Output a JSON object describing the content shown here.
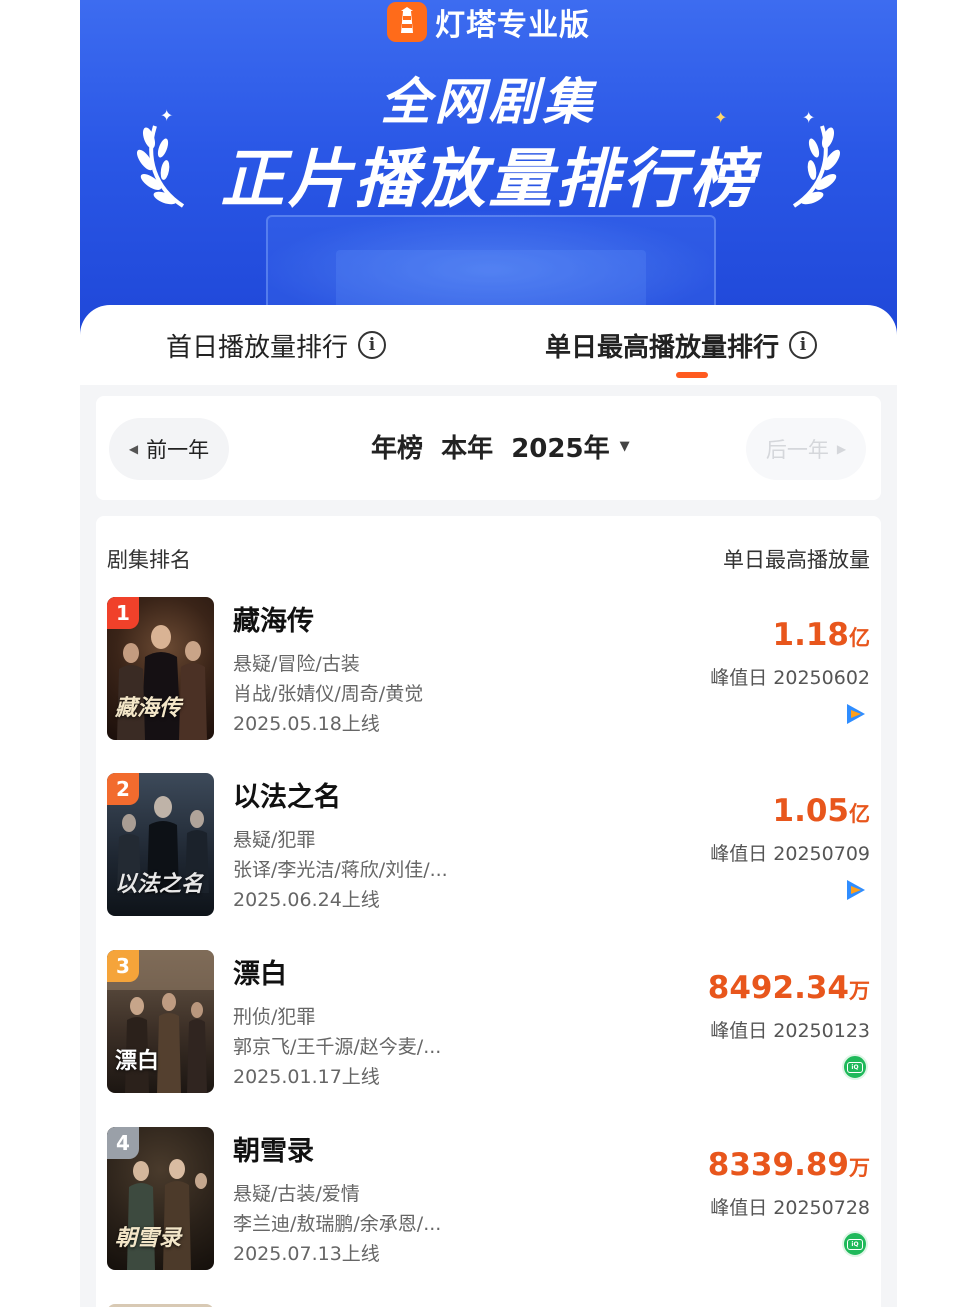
{
  "banner": {
    "brand_name": "灯塔专业版",
    "title_line1": "全网剧集",
    "title_line2": "正片播放量排行榜"
  },
  "tabs": [
    {
      "label": "首日播放量排行",
      "active": false
    },
    {
      "label": "单日最高播放量排行",
      "active": true
    }
  ],
  "year_nav": {
    "prev_label": "前一年",
    "current_label": "年榜  本年  2025年",
    "next_label": "后一年"
  },
  "list": {
    "header_left": "剧集排名",
    "header_right": "单日最高播放量",
    "items": [
      {
        "rank": "1",
        "title": "藏海传",
        "genre": "悬疑/冒险/古装",
        "cast": "肖战/张婧仪/周奇/黄觉",
        "release": "2025.05.18上线",
        "value": "1.18",
        "unit": "亿",
        "peak": "峰值日 20250602",
        "platform_icon": "tencent-video-icon",
        "poster_text": "藏海传",
        "rank_color": "#f0412a"
      },
      {
        "rank": "2",
        "title": "以法之名",
        "genre": "悬疑/犯罪",
        "cast": "张译/李光洁/蒋欣/刘佳/...",
        "release": "2025.06.24上线",
        "value": "1.05",
        "unit": "亿",
        "peak": "峰值日 20250709",
        "platform_icon": "tencent-video-icon",
        "poster_text": "以法之名",
        "rank_color": "#f26b2e"
      },
      {
        "rank": "3",
        "title": "漂白",
        "genre": "刑侦/犯罪",
        "cast": "郭京飞/王千源/赵今麦/...",
        "release": "2025.01.17上线",
        "value": "8492.34",
        "unit": "万",
        "peak": "峰值日 20250123",
        "platform_icon": "iqiyi-icon",
        "poster_text": "漂白",
        "rank_color": "#f5a43a"
      },
      {
        "rank": "4",
        "title": "朝雪录",
        "genre": "悬疑/古装/爱情",
        "cast": "李兰迪/敖瑞鹏/余承恩/...",
        "release": "2025.07.13上线",
        "value": "8339.89",
        "unit": "万",
        "peak": "峰值日 20250728",
        "platform_icon": "iqiyi-icon",
        "poster_text": "朝雪录",
        "rank_color": "#9aa0a8"
      }
    ]
  },
  "colors": {
    "accent": "#e8561c",
    "banner_blue": "#2a57e6",
    "iqiyi_green": "#1fb95a"
  }
}
